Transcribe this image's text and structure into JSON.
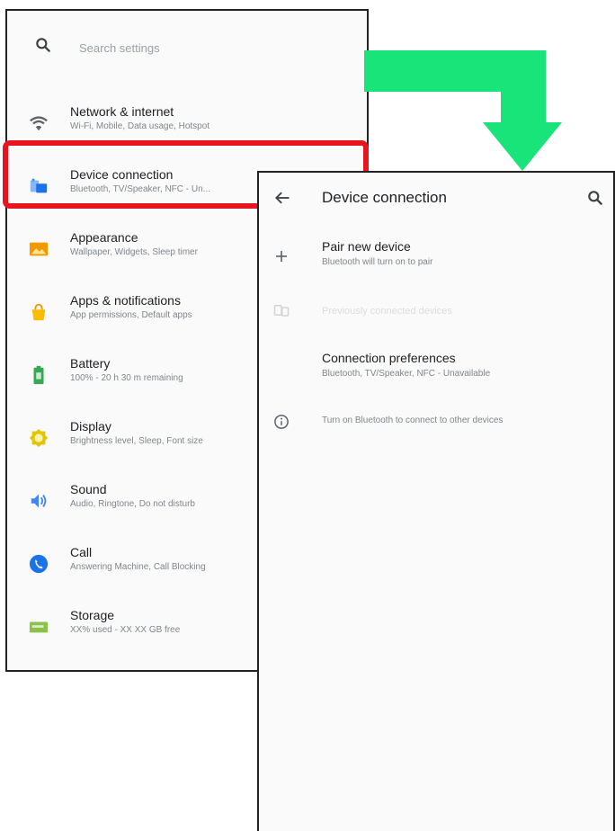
{
  "settings": {
    "search_placeholder": "Search settings",
    "items": [
      {
        "title": "Network & internet",
        "subtitle": "Wi-Fi, Mobile, Data usage, Hotspot",
        "icon": "wifi-icon",
        "color": "#5f6368"
      },
      {
        "title": "Device connection",
        "subtitle": "Bluetooth, TV/Speaker, NFC - Un...",
        "icon": "devices-icon",
        "color": "#4285f4"
      },
      {
        "title": "Appearance",
        "subtitle": "Wallpaper, Widgets, Sleep timer",
        "icon": "wallpaper-icon",
        "color": "#f29900"
      },
      {
        "title": "Apps & notifications",
        "subtitle": "App permissions, Default apps",
        "icon": "apps-icon",
        "color": "#fbbc04"
      },
      {
        "title": "Battery",
        "subtitle": "100% - 20 h 30 m remaining",
        "icon": "battery-icon",
        "color": "#34a853"
      },
      {
        "title": "Display",
        "subtitle": "Brightness level, Sleep, Font size",
        "icon": "display-icon",
        "color": "#e2c400"
      },
      {
        "title": "Sound",
        "subtitle": "Audio, Ringtone, Do not disturb",
        "icon": "sound-icon",
        "color": "#4285f4"
      },
      {
        "title": "Call",
        "subtitle": "Answering Machine, Call Blocking",
        "icon": "call-icon",
        "color": "#1a73e8"
      },
      {
        "title": "Storage",
        "subtitle": "XX% used - XX XX GB free",
        "icon": "storage-icon",
        "color": "#8bc34a"
      }
    ]
  },
  "device_connection": {
    "title": "Device connection",
    "pair_new_device": {
      "title": "Pair new device",
      "subtitle": "Bluetooth will turn on to pair"
    },
    "previously_connected": {
      "title": "Previously connected devices"
    },
    "connection_preferences": {
      "title": "Connection preferences",
      "subtitle": "Bluetooth, TV/Speaker, NFC - Unavailable"
    },
    "info_text": "Turn on Bluetooth to connect to other devices"
  },
  "colors": {
    "highlight": "#e8141e",
    "arrow": "#19e47a"
  }
}
